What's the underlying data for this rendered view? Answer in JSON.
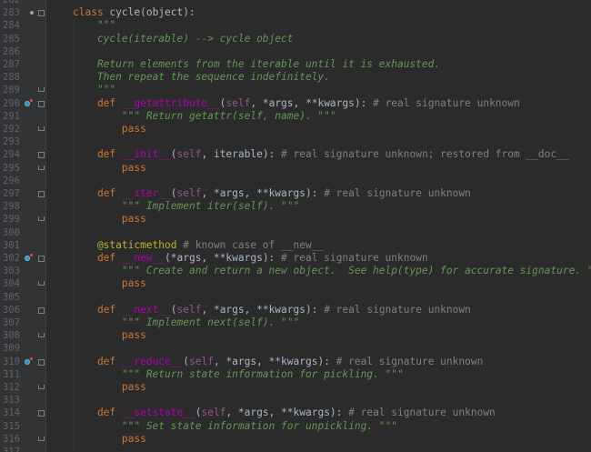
{
  "editor": {
    "lines": [
      {
        "n": "282",
        "tokens": []
      },
      {
        "n": "283",
        "tokens": [
          {
            "t": "kw",
            "v": "class "
          },
          {
            "t": "plain",
            "v": "cycle("
          },
          {
            "t": "plain",
            "v": "object"
          },
          {
            "t": "plain",
            "v": "):"
          }
        ]
      },
      {
        "n": "284",
        "tokens": [
          {
            "t": "doc",
            "v": "    \"\"\""
          }
        ]
      },
      {
        "n": "285",
        "tokens": [
          {
            "t": "doc",
            "v": "    cycle(iterable) --> cycle object"
          }
        ]
      },
      {
        "n": "286",
        "tokens": []
      },
      {
        "n": "287",
        "tokens": [
          {
            "t": "doc",
            "v": "    Return elements from the iterable until it is exhausted."
          }
        ]
      },
      {
        "n": "288",
        "tokens": [
          {
            "t": "doc",
            "v": "    Then repeat the sequence indefinitely."
          }
        ]
      },
      {
        "n": "289",
        "tokens": [
          {
            "t": "doc",
            "v": "    \"\"\""
          }
        ]
      },
      {
        "n": "290",
        "tokens": [
          {
            "t": "kw",
            "v": "    def "
          },
          {
            "t": "magic",
            "v": "__getattribute__"
          },
          {
            "t": "plain",
            "v": "("
          },
          {
            "t": "self",
            "v": "self"
          },
          {
            "t": "plain",
            "v": ", *args, **kwargs): "
          },
          {
            "t": "comment",
            "v": "# real signature unknown"
          }
        ]
      },
      {
        "n": "291",
        "tokens": [
          {
            "t": "doc",
            "v": "        \"\"\" Return getattr(self, name). \"\"\""
          }
        ]
      },
      {
        "n": "292",
        "tokens": [
          {
            "t": "kw",
            "v": "        pass"
          }
        ]
      },
      {
        "n": "293",
        "tokens": []
      },
      {
        "n": "294",
        "tokens": [
          {
            "t": "kw",
            "v": "    def "
          },
          {
            "t": "magic",
            "v": "__init__"
          },
          {
            "t": "plain",
            "v": "("
          },
          {
            "t": "self",
            "v": "self"
          },
          {
            "t": "plain",
            "v": ", iterable): "
          },
          {
            "t": "comment",
            "v": "# real signature unknown; restored from __doc__"
          }
        ]
      },
      {
        "n": "295",
        "tokens": [
          {
            "t": "kw",
            "v": "        pass"
          }
        ]
      },
      {
        "n": "296",
        "tokens": []
      },
      {
        "n": "297",
        "tokens": [
          {
            "t": "kw",
            "v": "    def "
          },
          {
            "t": "magic",
            "v": "__iter__"
          },
          {
            "t": "plain",
            "v": "("
          },
          {
            "t": "self",
            "v": "self"
          },
          {
            "t": "plain",
            "v": ", *args, **kwargs): "
          },
          {
            "t": "comment",
            "v": "# real signature unknown"
          }
        ]
      },
      {
        "n": "298",
        "tokens": [
          {
            "t": "doc",
            "v": "        \"\"\" Implement iter(self). \"\"\""
          }
        ]
      },
      {
        "n": "299",
        "tokens": [
          {
            "t": "kw",
            "v": "        pass"
          }
        ]
      },
      {
        "n": "300",
        "tokens": []
      },
      {
        "n": "301",
        "tokens": [
          {
            "t": "deco",
            "v": "    @staticmethod"
          },
          {
            "t": "comment",
            "v": " # known case of __new__"
          }
        ]
      },
      {
        "n": "302",
        "tokens": [
          {
            "t": "kw",
            "v": "    def "
          },
          {
            "t": "magic",
            "v": "__new__"
          },
          {
            "t": "plain",
            "v": "(*args, **kwargs): "
          },
          {
            "t": "comment",
            "v": "# real signature unknown"
          }
        ]
      },
      {
        "n": "303",
        "tokens": [
          {
            "t": "doc",
            "v": "        \"\"\" Create and return a new object.  See help(type) for accurate signature. \"\"\""
          }
        ]
      },
      {
        "n": "304",
        "tokens": [
          {
            "t": "kw",
            "v": "        pass"
          }
        ]
      },
      {
        "n": "305",
        "tokens": []
      },
      {
        "n": "306",
        "tokens": [
          {
            "t": "kw",
            "v": "    def "
          },
          {
            "t": "magic",
            "v": "__next__"
          },
          {
            "t": "plain",
            "v": "("
          },
          {
            "t": "self",
            "v": "self"
          },
          {
            "t": "plain",
            "v": ", *args, **kwargs): "
          },
          {
            "t": "comment",
            "v": "# real signature unknown"
          }
        ]
      },
      {
        "n": "307",
        "tokens": [
          {
            "t": "doc",
            "v": "        \"\"\" Implement next(self). \"\"\""
          }
        ]
      },
      {
        "n": "308",
        "tokens": [
          {
            "t": "kw",
            "v": "        pass"
          }
        ]
      },
      {
        "n": "309",
        "tokens": []
      },
      {
        "n": "310",
        "tokens": [
          {
            "t": "kw",
            "v": "    def "
          },
          {
            "t": "magic",
            "v": "__reduce__"
          },
          {
            "t": "plain",
            "v": "("
          },
          {
            "t": "self",
            "v": "self"
          },
          {
            "t": "plain",
            "v": ", *args, **kwargs): "
          },
          {
            "t": "comment",
            "v": "# real signature unknown"
          }
        ]
      },
      {
        "n": "311",
        "tokens": [
          {
            "t": "doc",
            "v": "        \"\"\" Return state information for pickling. \"\"\""
          }
        ]
      },
      {
        "n": "312",
        "tokens": [
          {
            "t": "kw",
            "v": "        pass"
          }
        ]
      },
      {
        "n": "313",
        "tokens": []
      },
      {
        "n": "314",
        "tokens": [
          {
            "t": "kw",
            "v": "    def "
          },
          {
            "t": "magic",
            "v": "__setstate__"
          },
          {
            "t": "plain",
            "v": "("
          },
          {
            "t": "self",
            "v": "self"
          },
          {
            "t": "plain",
            "v": ", *args, **kwargs): "
          },
          {
            "t": "comment",
            "v": "# real signature unknown"
          }
        ]
      },
      {
        "n": "315",
        "tokens": [
          {
            "t": "doc",
            "v": "        \"\"\" Set state information for unpickling. \"\"\""
          }
        ]
      },
      {
        "n": "316",
        "tokens": [
          {
            "t": "kw",
            "v": "        pass"
          }
        ]
      },
      {
        "n": "317",
        "tokens": []
      }
    ],
    "override_marker_lines": [
      "290",
      "302",
      "310"
    ],
    "colors": {
      "background": "#2b2b2b",
      "gutter": "#313335",
      "keyword": "#cc7832",
      "docstring": "#629755",
      "comment": "#808080",
      "magic_method": "#b200b2",
      "self": "#94558d",
      "decorator": "#bbb529"
    }
  }
}
